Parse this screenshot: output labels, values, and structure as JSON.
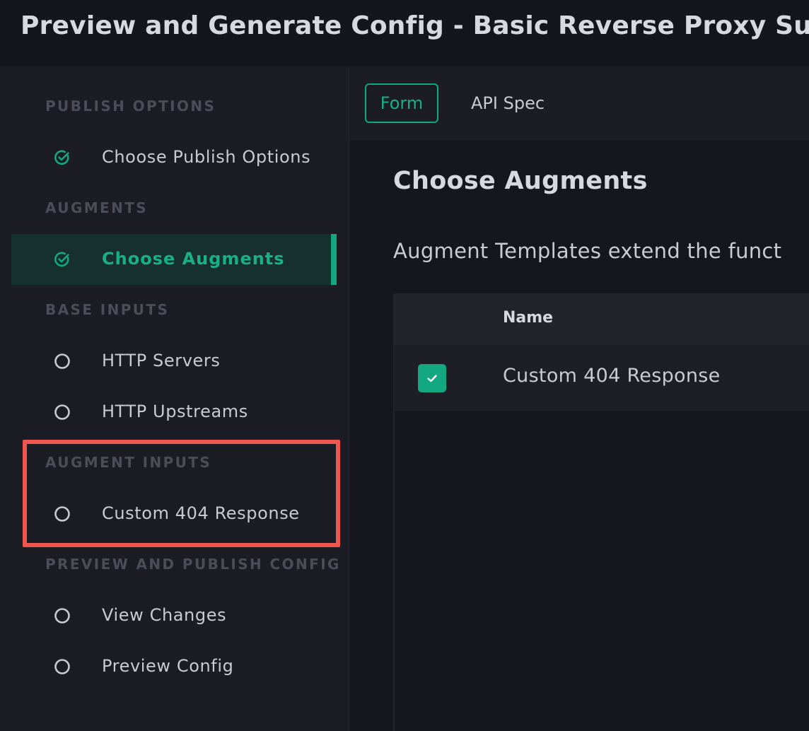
{
  "window": {
    "title": "Preview and Generate Config - Basic Reverse Proxy Sub"
  },
  "sidebar": {
    "sections": [
      {
        "header": "PUBLISH OPTIONS",
        "items": [
          {
            "label": "Choose Publish Options",
            "status": "complete",
            "icon": "check-circle-icon"
          }
        ]
      },
      {
        "header": "AUGMENTS",
        "items": [
          {
            "label": "Choose Augments",
            "status": "complete",
            "active": true,
            "icon": "check-circle-icon"
          }
        ]
      },
      {
        "header": "BASE INPUTS",
        "items": [
          {
            "label": "HTTP Servers",
            "status": "incomplete",
            "icon": "empty-circle-icon"
          },
          {
            "label": "HTTP Upstreams",
            "status": "incomplete",
            "icon": "empty-circle-icon"
          }
        ]
      },
      {
        "header": "AUGMENT INPUTS",
        "highlighted": true,
        "items": [
          {
            "label": "Custom 404 Response",
            "status": "incomplete",
            "icon": "empty-circle-icon"
          }
        ]
      },
      {
        "header": "PREVIEW AND PUBLISH CONFIG",
        "items": [
          {
            "label": "View Changes",
            "status": "incomplete",
            "icon": "empty-circle-icon"
          },
          {
            "label": "Preview Config",
            "status": "incomplete",
            "icon": "empty-circle-icon"
          }
        ]
      }
    ]
  },
  "tabs": [
    {
      "label": "Form",
      "selected": true
    },
    {
      "label": "API Spec",
      "selected": false
    }
  ],
  "main": {
    "heading": "Choose Augments",
    "description": "Augment Templates extend the funct",
    "table": {
      "columns": [
        "",
        "Name"
      ],
      "rows": [
        {
          "selected": true,
          "name": "Custom 404 Response"
        }
      ]
    }
  },
  "colors": {
    "accent": "#14a882",
    "highlight_border": "#f0564f",
    "sidebar_bg": "#1b1c24",
    "page_bg": "#16171e"
  }
}
